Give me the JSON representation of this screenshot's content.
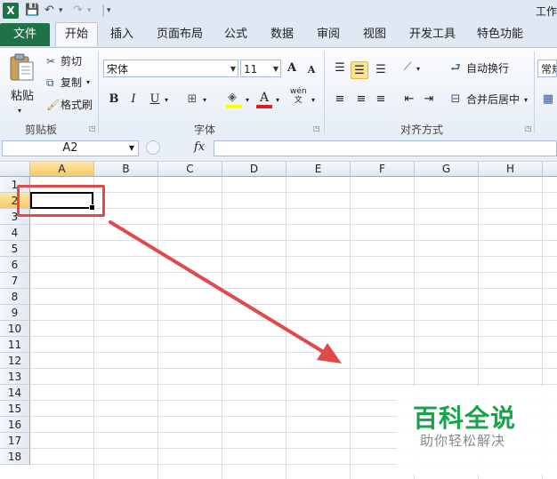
{
  "qat": {
    "app_icon": "X",
    "title": "工作",
    "save_icon": "💾",
    "undo_icon": "↶",
    "redo_icon": "↷",
    "dropdown_icon": "▾",
    "customize_icon": "▾"
  },
  "tabs": {
    "file": "文件",
    "items": [
      "开始",
      "插入",
      "页面布局",
      "公式",
      "数据",
      "审阅",
      "视图",
      "开发工具",
      "特色功能"
    ],
    "active": "开始"
  },
  "ribbon": {
    "clipboard": {
      "paste": "粘贴",
      "cut": "剪切",
      "copy": "复制",
      "format_painter": "格式刷",
      "label": "剪贴板"
    },
    "font": {
      "name": "宋体",
      "size": "11",
      "grow": "A",
      "shrink": "A",
      "bold": "B",
      "italic": "I",
      "underline": "U",
      "font_color": "A",
      "wen": "wén\n文",
      "label": "字体"
    },
    "alignment": {
      "wrap": "自动换行",
      "merge": "合并后居中",
      "label": "对齐方式"
    },
    "number": {
      "format": "常规"
    }
  },
  "formula_bar": {
    "name_box": "A2",
    "fx": "fx",
    "value": ""
  },
  "sheet": {
    "columns": [
      "A",
      "B",
      "C",
      "D",
      "E",
      "F",
      "G",
      "H"
    ],
    "rows": [
      "1",
      "2",
      "3",
      "4",
      "5",
      "6",
      "7",
      "8",
      "9",
      "10",
      "11",
      "12",
      "13",
      "14",
      "15",
      "16",
      "17",
      "18"
    ],
    "active_cell": "A2",
    "active_col": "A",
    "active_row": "2"
  },
  "watermark": {
    "title": "百科全说",
    "subtitle": "助你轻松解决"
  },
  "colors": {
    "file_tab": "#1f7246",
    "annotation": "#e04a4a",
    "watermark": "#1aa24a"
  }
}
